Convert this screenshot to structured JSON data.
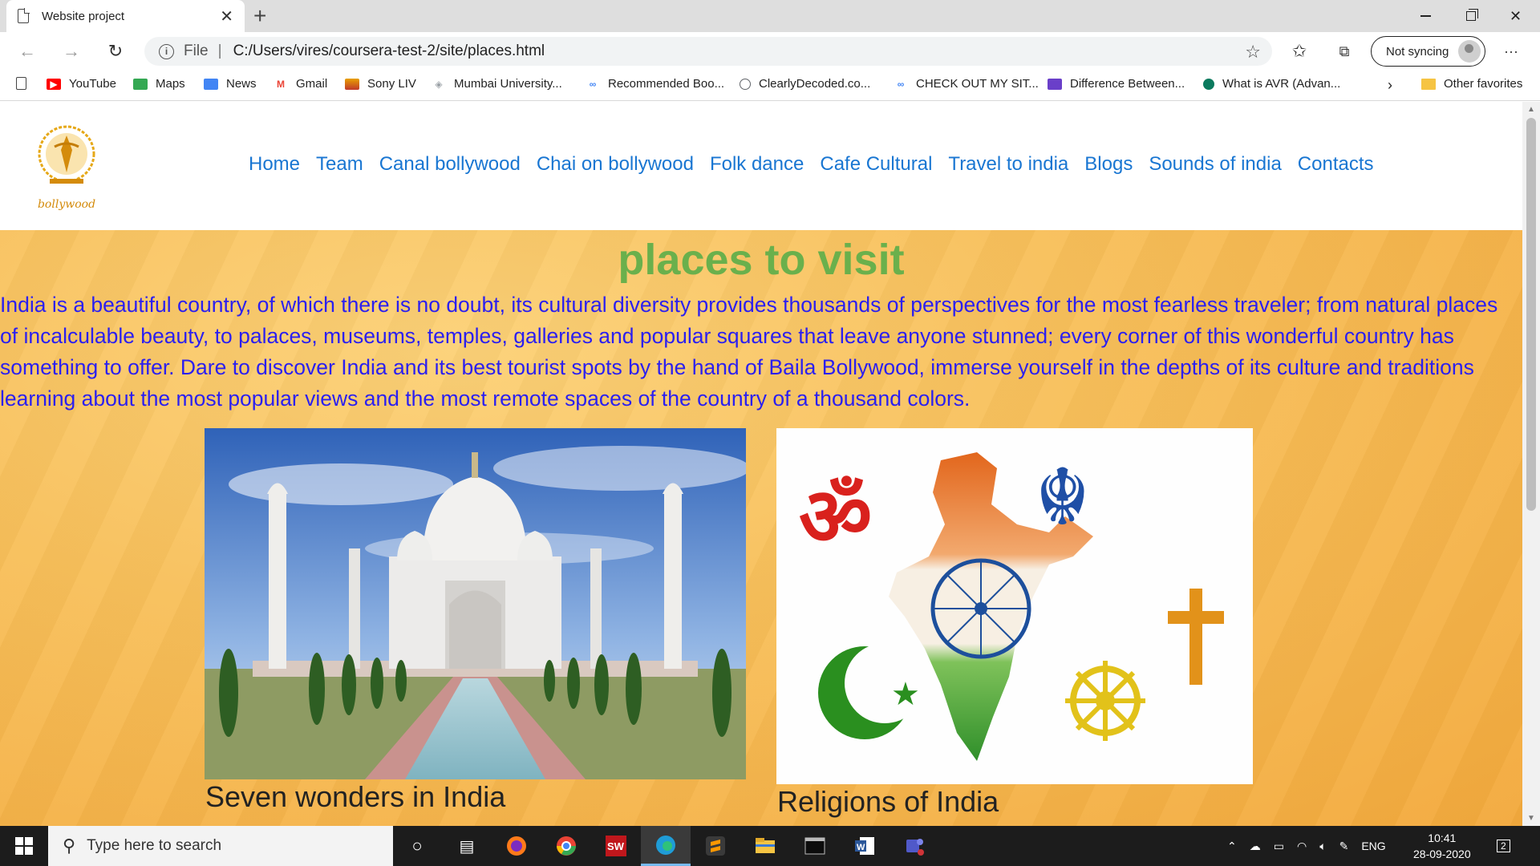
{
  "browser": {
    "tab_title": "Website project",
    "url_scheme_label": "File",
    "url": "C:/Users/vires/coursera-test-2/site/places.html",
    "sync_label": "Not syncing",
    "more_label": "···"
  },
  "bookmarks": [
    {
      "label": "YouTube",
      "icon": "youtube-icon",
      "color": "#ff0000"
    },
    {
      "label": "Maps",
      "icon": "maps-icon",
      "color": "#34a853"
    },
    {
      "label": "News",
      "icon": "news-icon",
      "color": "#4285f4"
    },
    {
      "label": "Gmail",
      "icon": "gmail-icon",
      "color": "#ea4335"
    },
    {
      "label": "Sony LIV",
      "icon": "sonyliv-icon",
      "color": "#e8a000"
    },
    {
      "label": "Mumbai University...",
      "icon": "university-icon",
      "color": "#9aa0a6"
    },
    {
      "label": "Recommended Boo...",
      "icon": "link-icon",
      "color": "#4285f4"
    },
    {
      "label": "ClearlyDecoded.co...",
      "icon": "site-icon",
      "color": "#5f6368"
    },
    {
      "label": "CHECK OUT MY SIT...",
      "icon": "link-icon",
      "color": "#4285f4"
    },
    {
      "label": "Difference Between...",
      "icon": "site-icon",
      "color": "#6a3fc9"
    },
    {
      "label": "What is AVR (Advan...",
      "icon": "site-icon",
      "color": "#0b7a5e"
    }
  ],
  "other_favorites": "Other favorites",
  "site": {
    "logo_text": "bollywood",
    "nav": [
      "Home",
      "Team",
      "Canal bollywood",
      "Chai on bollywood",
      "Folk dance",
      "Cafe Cultural",
      "Travel to india",
      "Blogs",
      "Sounds of india",
      "Contacts"
    ],
    "title": "places to visit",
    "intro": "India is a beautiful country, of which there is no doubt, its cultural diversity provides thousands of perspectives for the most fearless traveler; from natural places of incalculable beauty, to palaces, museums, temples, galleries and popular squares that leave anyone stunned; every corner of this wonderful country has something to offer. Dare to discover India and its best tourist spots by the hand of Baila Bollywood, immerse yourself in the depths of its culture and traditions learning about the most popular views and the most remote spaces of the country of a thousand colors.",
    "cards": [
      {
        "caption": "Seven wonders in India",
        "image": "taj-mahal-photo"
      },
      {
        "caption": "Religions of India",
        "image": "india-religions-map"
      }
    ]
  },
  "taskbar": {
    "search_placeholder": "Type here to search",
    "language": "ENG",
    "time": "10:41",
    "date": "28-09-2020",
    "notifications": "2",
    "apps": [
      "task-view-icon",
      "task-switch-icon",
      "firefox-icon",
      "chrome-icon",
      "solidworks-icon",
      "edge-icon",
      "sublime-icon",
      "file-explorer-icon",
      "terminal-icon",
      "word-icon",
      "teams-icon"
    ]
  },
  "colors": {
    "nav_link": "#1976d2",
    "title": "#6ab04c",
    "intro_text": "#2b1ff0",
    "background": "#f8c05b"
  }
}
